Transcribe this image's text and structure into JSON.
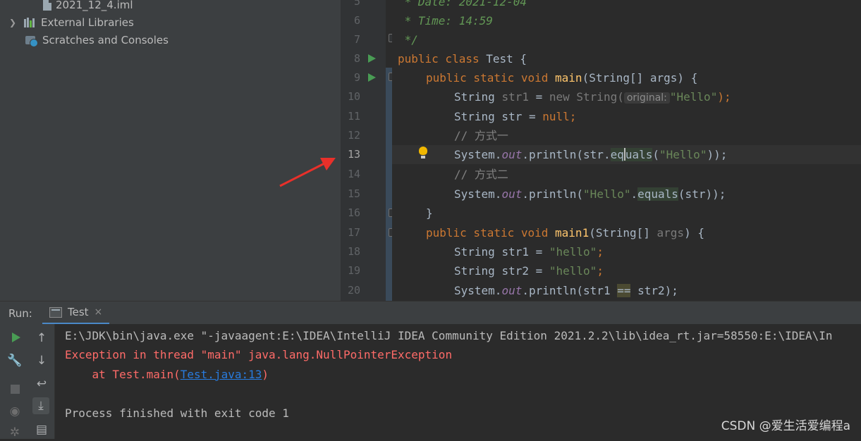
{
  "project_tree": {
    "items": [
      {
        "label": "2021_12_4.iml",
        "icon": "iml-file-icon"
      },
      {
        "label": "External Libraries",
        "icon": "library-icon"
      },
      {
        "label": "Scratches and Consoles",
        "icon": "scratches-icon"
      }
    ]
  },
  "editor": {
    "line_numbers": [
      "5",
      "6",
      "7",
      "8",
      "9",
      "10",
      "11",
      "12",
      "13",
      "14",
      "15",
      "16",
      "17",
      "18",
      "19",
      "20"
    ],
    "current_line": "13",
    "lines": {
      "l5": " * Date: 2021-12-04",
      "l6": " * Time: 14:59",
      "l7": " */",
      "l8_kw": "public class ",
      "l8_name": "Test {",
      "l9_kw": "public static void ",
      "l9_fn": "main",
      "l9_rest": "(String[] args) {",
      "l10_a": "String ",
      "l10_var": "str1",
      "l10_b": " = ",
      "l10_new": "new String(",
      "l10_hint": "original:",
      "l10_str": "\"Hello\"",
      "l10_end": ");",
      "l11_a": "String str = ",
      "l11_null": "null",
      "l11_end": ";",
      "l12": "// 方式一",
      "l13_a": "System.",
      "l13_out": "out",
      "l13_b": ".println(str.",
      "l13_eq1": "eq",
      "l13_eq2": "uals",
      "l13_str": "\"Hello\"",
      "l13_end": "));",
      "l14": "// 方式二",
      "l15_a": "System.",
      "l15_out": "out",
      "l15_b": ".println(",
      "l15_str": "\"Hello\"",
      "l15_c": ".",
      "l15_eq": "equals",
      "l15_end": "(str));",
      "l16": "}",
      "l17_kw": "public static void ",
      "l17_fn": "main1",
      "l17_a": "(String[] ",
      "l17_args": "args",
      "l17_end": ") {",
      "l18_a": "String ",
      "l18_var": "str1",
      "l18_b": " = ",
      "l18_str": "\"hello\"",
      "l18_end": ";",
      "l19_a": "String ",
      "l19_var": "str2",
      "l19_b": " = ",
      "l19_str": "\"hello\"",
      "l19_end": ";",
      "l20_a": "System.",
      "l20_out": "out",
      "l20_b": ".println(str1 ",
      "l20_eq": "==",
      "l20_end": " str2);"
    }
  },
  "run_panel": {
    "label": "Run:",
    "tab_label": "Test",
    "close_glyph": "×",
    "toolbar_glyphs": {
      "up": "↑",
      "down": "↓",
      "wrap": "↩",
      "scroll": "⤓",
      "print": "▤",
      "wrench": "🔧",
      "camera": "◉",
      "gear": "✲"
    },
    "console": {
      "cmd": "E:\\JDK\\bin\\java.exe \"-javaagent:E:\\IDEA\\IntelliJ IDEA Community Edition 2021.2.2\\lib\\idea_rt.jar=58550:E:\\IDEA\\In",
      "exception": "Exception in thread \"main\" java.lang.NullPointerException",
      "at_prefix": "    at Test.main(",
      "at_link": "Test.java:13",
      "at_suffix": ")",
      "finished": "Process finished with exit code 1"
    }
  },
  "watermark": "CSDN @爱生活爱编程a",
  "colors": {
    "keyword": "#cc7832",
    "string": "#6a8759",
    "error": "#ff6b68",
    "link": "#287bde",
    "arrow": "#e8302a"
  }
}
